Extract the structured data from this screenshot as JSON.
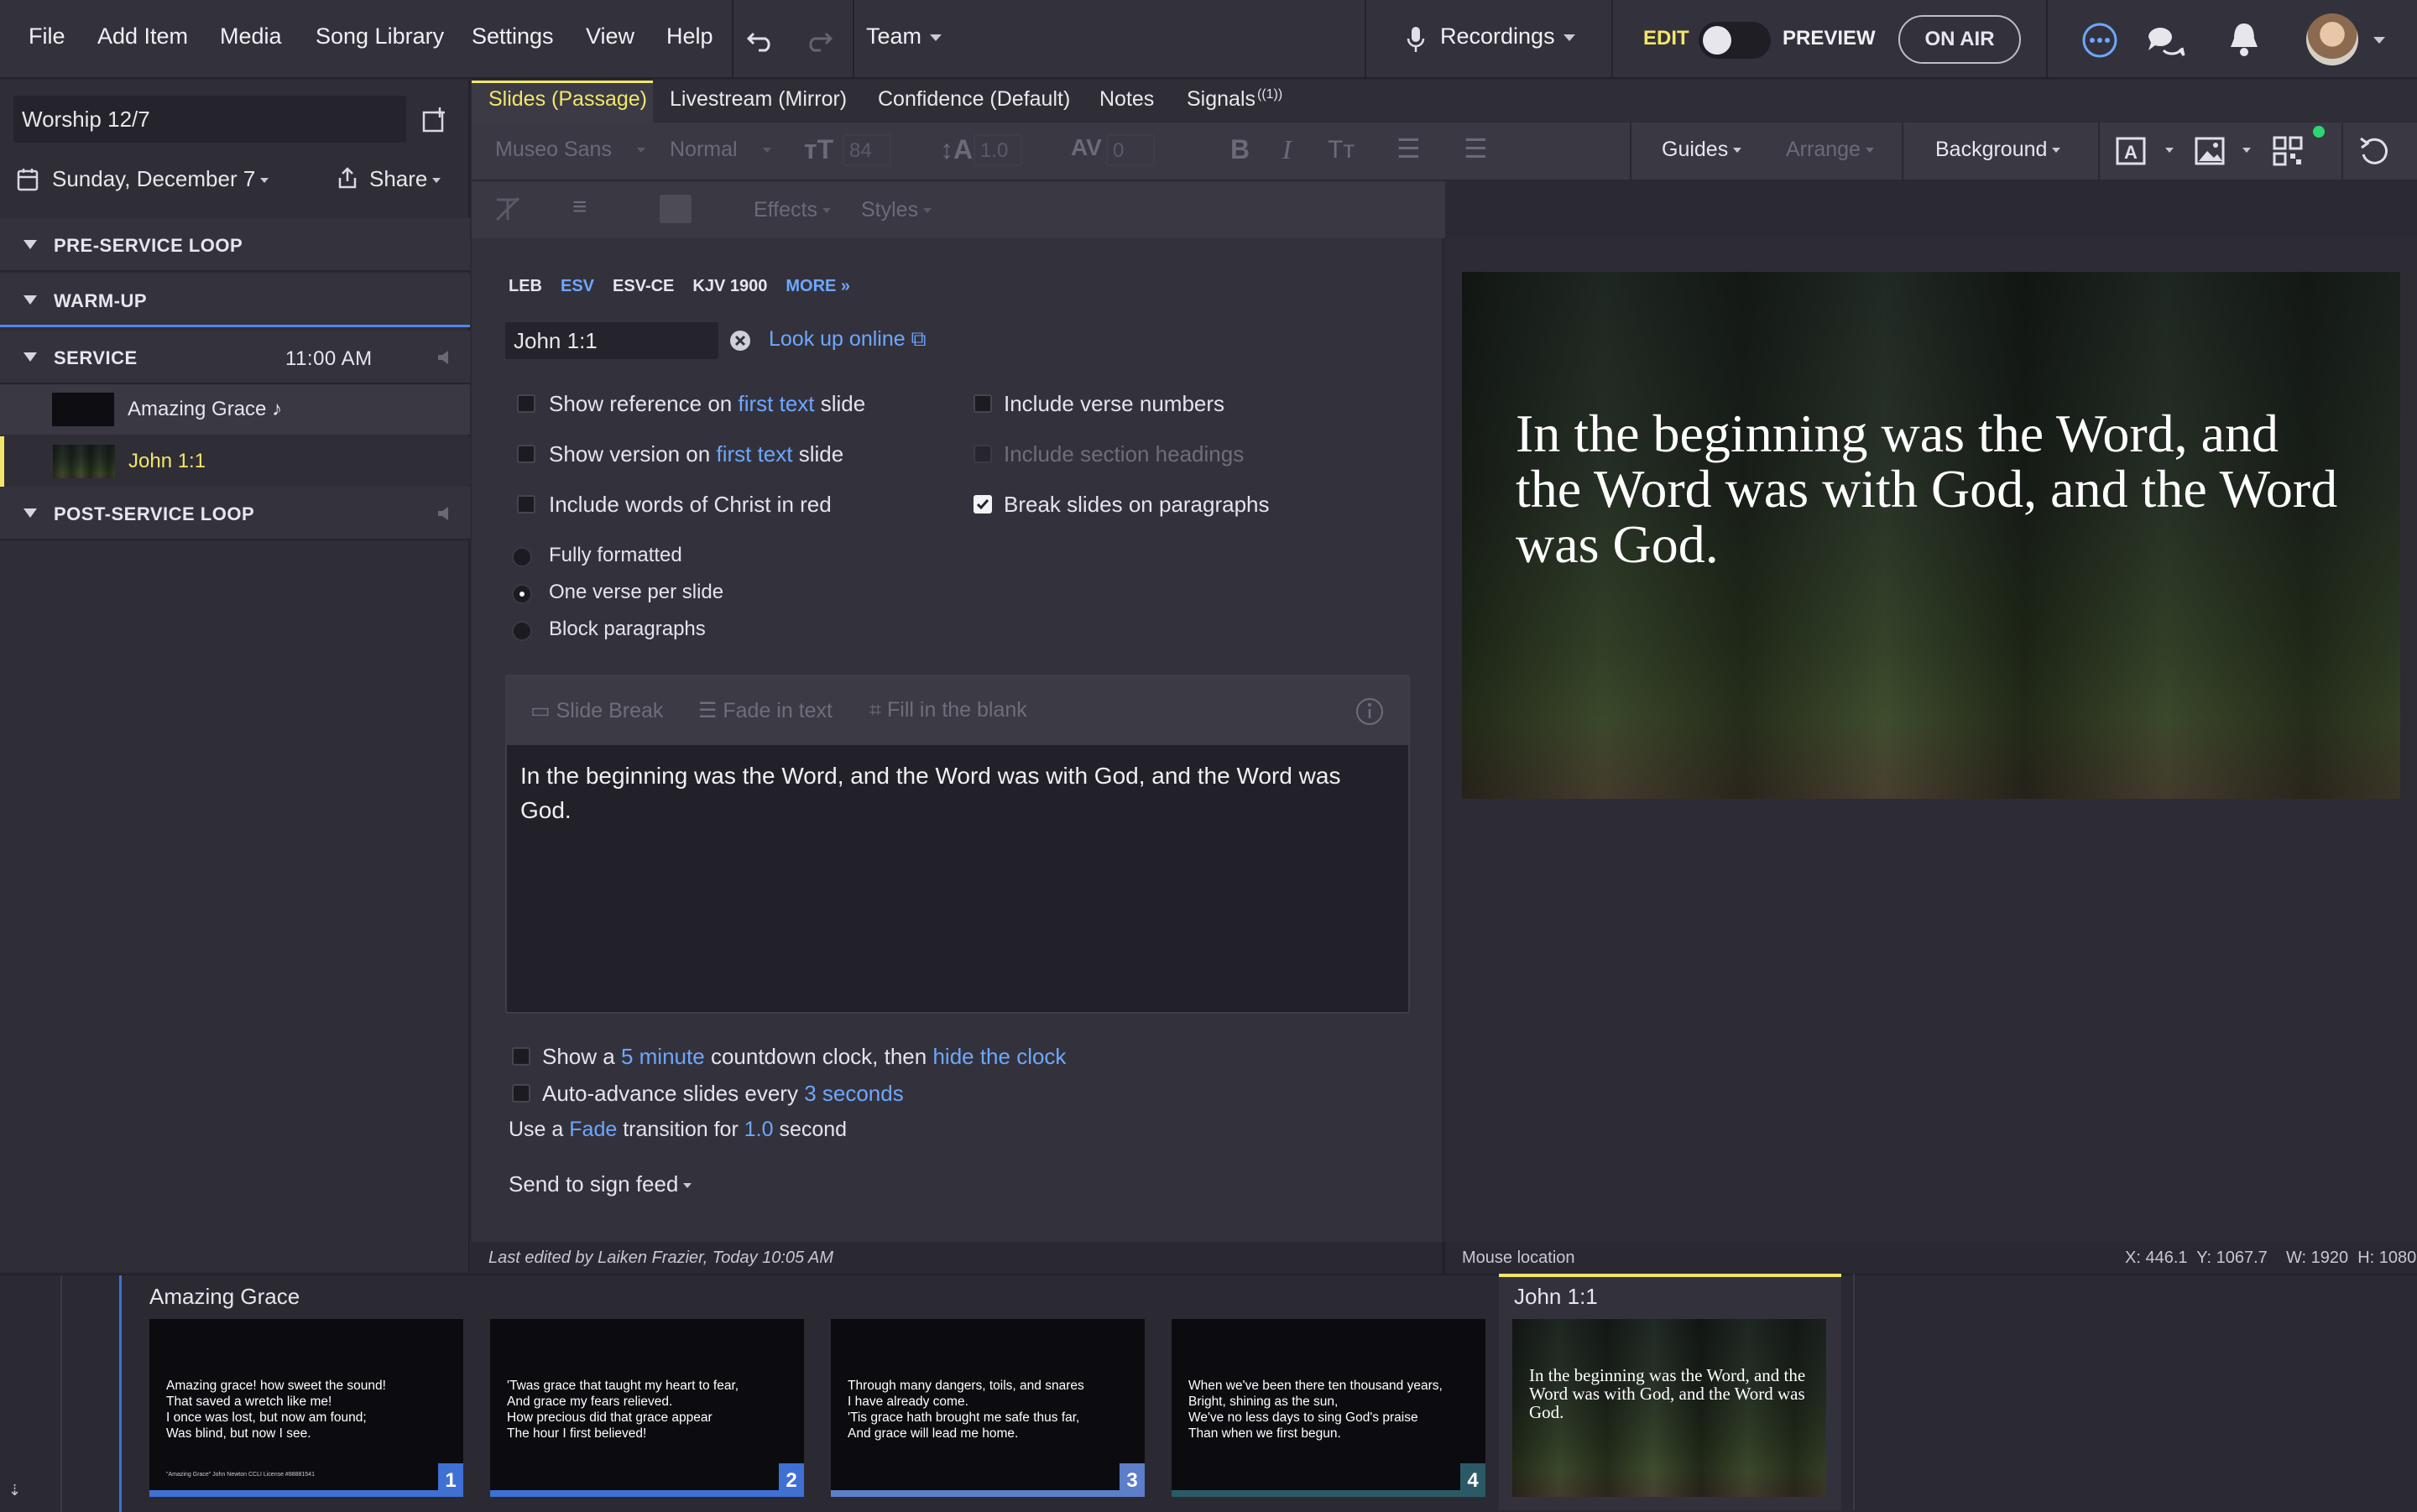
{
  "menu": {
    "file": "File",
    "add_item": "Add Item",
    "media": "Media",
    "song_library": "Song Library",
    "settings": "Settings",
    "view": "View",
    "help": "Help",
    "team": "Team"
  },
  "header": {
    "recordings": "Recordings",
    "edit": "EDIT",
    "preview": "PREVIEW",
    "on_air": "ON AIR"
  },
  "plan": {
    "name": "Worship 12/7",
    "date": "Sunday, December 7",
    "share": "Share"
  },
  "sections": [
    {
      "label": "PRE-SERVICE LOOP",
      "time": ""
    },
    {
      "label": "WARM-UP",
      "time": ""
    },
    {
      "label": "SERVICE",
      "time": "11:00 AM"
    },
    {
      "label": "POST-SERVICE LOOP",
      "time": ""
    }
  ],
  "service_items": [
    {
      "label": "Amazing Grace ♪",
      "selected": false
    },
    {
      "label": "John 1:1",
      "selected": true
    }
  ],
  "tabs": [
    "Slides (Passage)",
    "Livestream (Mirror)",
    "Confidence (Default)",
    "Notes",
    "Signals"
  ],
  "signals_badge": "((1))",
  "toolbar": {
    "font": "Museo Sans",
    "weight": "Normal",
    "size": "84",
    "line_height": "1.0",
    "tracking": "0",
    "guides": "Guides",
    "arrange": "Arrange",
    "background": "Background",
    "effects": "Effects",
    "styles": "Styles"
  },
  "editor": {
    "versions": [
      "LEB",
      "ESV",
      "ESV-CE",
      "KJV 1900",
      "MORE »"
    ],
    "active_version": "ESV",
    "reference": "John 1:1",
    "lookup": "Look up online",
    "opt_show_ref": {
      "pre": "Show reference on",
      "link": "first text",
      "post": "slide",
      "checked": false
    },
    "opt_show_ver": {
      "pre": "Show version on",
      "link": "first text",
      "post": "slide",
      "checked": false
    },
    "opt_words_red": {
      "label": "Include words of Christ in red",
      "checked": false
    },
    "opt_verse_nums": {
      "label": "Include verse numbers",
      "checked": false
    },
    "opt_section_heads": {
      "label": "Include section headings",
      "checked": false
    },
    "opt_break_paras": {
      "label": "Break slides on paragraphs",
      "checked": true
    },
    "format_options": [
      "Fully formatted",
      "One verse per slide",
      "Block paragraphs"
    ],
    "format_selected": "One verse per slide",
    "text_tools": {
      "slide_break": "Slide Break",
      "fade_in": "Fade in text",
      "fill_blank": "Fill in the blank"
    },
    "passage_text": "In the beginning was the Word, and the Word was with God, and the Word was God.",
    "countdown": {
      "pre": "Show a",
      "link1": "5 minute",
      "mid": "countdown clock, then",
      "link2": "hide the clock"
    },
    "auto_advance": {
      "pre": "Auto-advance slides every",
      "link": "3 seconds"
    },
    "transition": {
      "pre": "Use a",
      "link1": "Fade",
      "mid": "transition",
      "for": "for",
      "link2": "1.0",
      "post": "second"
    },
    "sign_feed": "Send to sign feed",
    "last_edited": "Last edited by Laiken Frazier, Today 10:05 AM"
  },
  "preview": {
    "text": "In the beginning was the Word, and the Word was with God, and the Word was God.",
    "mouse_label": "Mouse location",
    "coords": "X: 446.1  Y: 1067.7    W: 1920  H: 1080"
  },
  "strip": {
    "group1_title": "Amazing Grace",
    "group2_title": "John 1:1",
    "slides": [
      {
        "text": "Amazing grace! how sweet the sound!\nThat saved a wretch like me!\nI once was lost, but now am found;\nWas blind, but now I see.",
        "num": "1",
        "footer": "\"Amazing Grace\" John Newton CCLI License #88881541"
      },
      {
        "text": "'Twas grace that taught my heart to fear,\nAnd grace my fears relieved.\nHow precious did that grace appear\nThe hour I first believed!",
        "num": "2"
      },
      {
        "text": "Through many dangers, toils, and snares\nI have already come.\n'Tis grace hath brought me safe thus far,\nAnd grace will lead me home.",
        "num": "3"
      },
      {
        "text": "When we've been there ten thousand years,\nBright, shining as the sun,\nWe've no less days to sing God's praise\nThan when we first begun.",
        "num": "4"
      }
    ],
    "john_slide": "In the beginning was the Word, and the Word was with God, and the Word was God."
  },
  "colors": {
    "accent": "#6ea7ff",
    "highlight": "#f2e66a",
    "slide_blue": "#3f70d4",
    "bg_dark": "#2b2a34"
  }
}
